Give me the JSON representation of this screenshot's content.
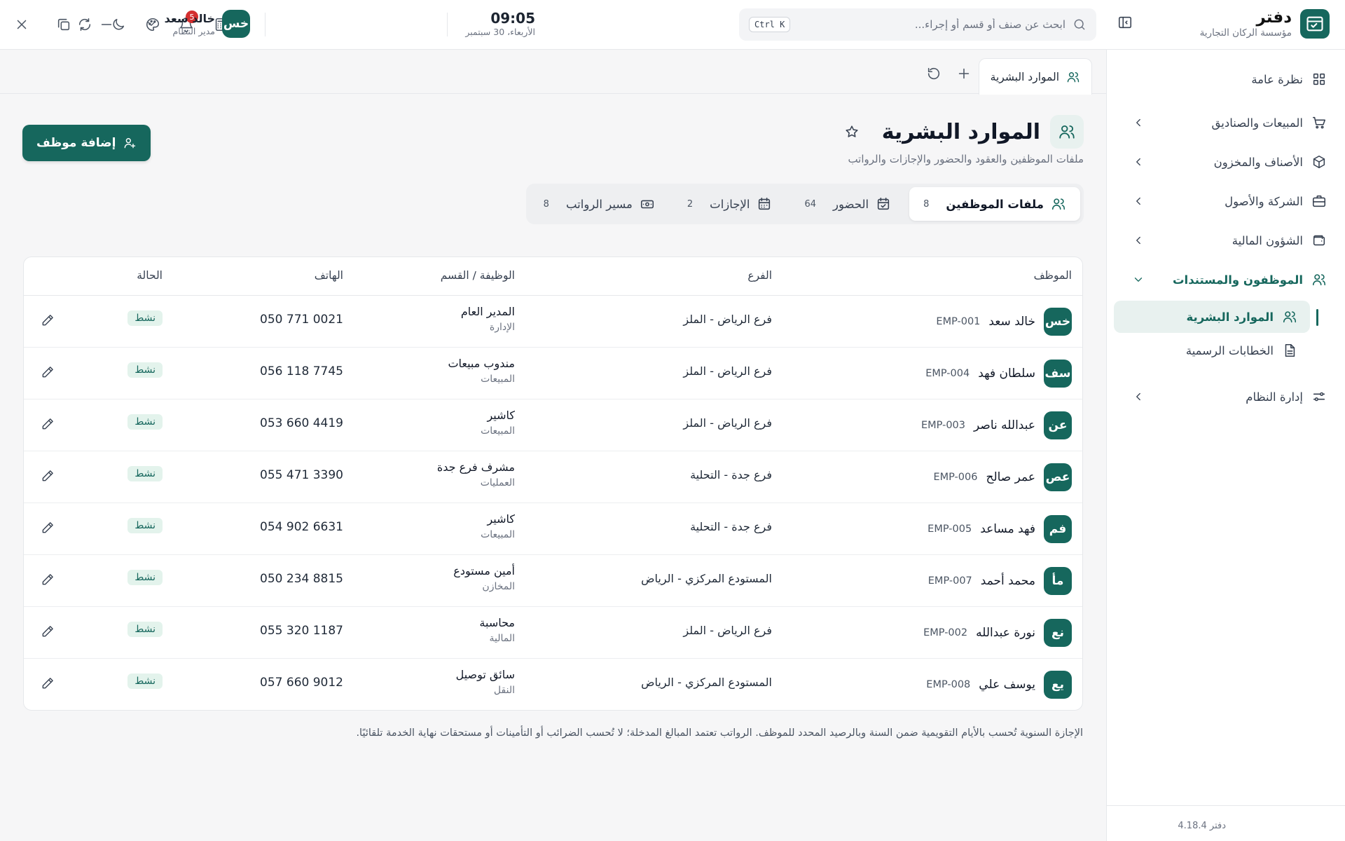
{
  "brand": {
    "name": "دفتر",
    "company": "مؤسسة الركان التجارية"
  },
  "search": {
    "placeholder": "ابحث عن صنف أو قسم أو إجراء...",
    "shortcut": "Ctrl K"
  },
  "clock": {
    "time": "09:05",
    "date": "الأربعاء، 30 سبتمبر"
  },
  "notifications": {
    "count": "5"
  },
  "user": {
    "initials": "خس",
    "name": "خالد سعد",
    "role": "مدير النظام"
  },
  "sidebar": {
    "items": [
      {
        "label": "نظرة عامة",
        "icon": "dashboard-icon"
      },
      {
        "label": "المبيعات والصناديق",
        "icon": "cart-icon"
      },
      {
        "label": "الأصناف والمخزون",
        "icon": "box-icon"
      },
      {
        "label": "الشركة والأصول",
        "icon": "briefcase-icon"
      },
      {
        "label": "الشؤون المالية",
        "icon": "wallet-icon"
      },
      {
        "label": "الموظفون والمستندات",
        "icon": "users-icon"
      },
      {
        "label": "إدارة النظام",
        "icon": "sliders-icon"
      }
    ],
    "sub_items": [
      {
        "label": "الموارد البشرية",
        "icon": "users-icon"
      },
      {
        "label": "الخطابات الرسمية",
        "icon": "document-icon"
      }
    ],
    "version": "دفتر 4.18.4"
  },
  "page_tab": {
    "label": "الموارد البشرية"
  },
  "page": {
    "title": "الموارد البشرية",
    "subtitle": "ملفات الموظفين والعقود والحضور والإجازات والرواتب",
    "add_button": "إضافة موظف"
  },
  "segments": [
    {
      "label": "ملفات الموظفين",
      "count": "8",
      "icon": "users-icon"
    },
    {
      "label": "الحضور",
      "count": "64",
      "icon": "calendar-check-icon"
    },
    {
      "label": "الإجازات",
      "count": "2",
      "icon": "calendar-icon"
    },
    {
      "label": "مسير الرواتب",
      "count": "8",
      "icon": "cash-icon"
    }
  ],
  "table": {
    "headers": {
      "employee": "الموظف",
      "branch": "الفرع",
      "job": "الوظيفة / القسم",
      "phone": "الهاتف",
      "status": "الحالة"
    },
    "rows": [
      {
        "initials": "خس",
        "name": "خالد سعد",
        "code": "EMP-001",
        "branch": "فرع الرياض - الملز",
        "job": "المدير العام",
        "dept": "الإدارة",
        "phone": "050 771 0021",
        "status": "نشط"
      },
      {
        "initials": "سف",
        "name": "سلطان فهد",
        "code": "EMP-004",
        "branch": "فرع الرياض - الملز",
        "job": "مندوب مبيعات",
        "dept": "المبيعات",
        "phone": "056 118 7745",
        "status": "نشط"
      },
      {
        "initials": "عن",
        "name": "عبدالله ناصر",
        "code": "EMP-003",
        "branch": "فرع الرياض - الملز",
        "job": "كاشير",
        "dept": "المبيعات",
        "phone": "053 660 4419",
        "status": "نشط"
      },
      {
        "initials": "عص",
        "name": "عمر صالح",
        "code": "EMP-006",
        "branch": "فرع جدة - التحلية",
        "job": "مشرف فرع جدة",
        "dept": "العمليات",
        "phone": "055 471 3390",
        "status": "نشط"
      },
      {
        "initials": "فم",
        "name": "فهد مساعد",
        "code": "EMP-005",
        "branch": "فرع جدة - التحلية",
        "job": "كاشير",
        "dept": "المبيعات",
        "phone": "054 902 6631",
        "status": "نشط"
      },
      {
        "initials": "مأ",
        "name": "محمد أحمد",
        "code": "EMP-007",
        "branch": "المستودع المركزي - الرياض",
        "job": "أمين مستودع",
        "dept": "المخازن",
        "phone": "050 234 8815",
        "status": "نشط"
      },
      {
        "initials": "نع",
        "name": "نورة عبدالله",
        "code": "EMP-002",
        "branch": "فرع الرياض - الملز",
        "job": "محاسبة",
        "dept": "المالية",
        "phone": "055 320 1187",
        "status": "نشط"
      },
      {
        "initials": "يع",
        "name": "يوسف علي",
        "code": "EMP-008",
        "branch": "المستودع المركزي - الرياض",
        "job": "سائق توصيل",
        "dept": "النقل",
        "phone": "057 660 9012",
        "status": "نشط"
      }
    ]
  },
  "footnote": "الإجازة السنوية تُحسب بالأيام التقويمية ضمن السنة وبالرصيد المحدد للموظف. الرواتب تعتمد المبالغ المدخلة؛ لا تُحسب الضرائب أو التأمينات أو مستحقات نهاية الخدمة تلقائيًا.",
  "colors": {
    "accent": "#16675d",
    "accent_light": "#e8f1ef",
    "badge_red": "#d32f2f"
  }
}
